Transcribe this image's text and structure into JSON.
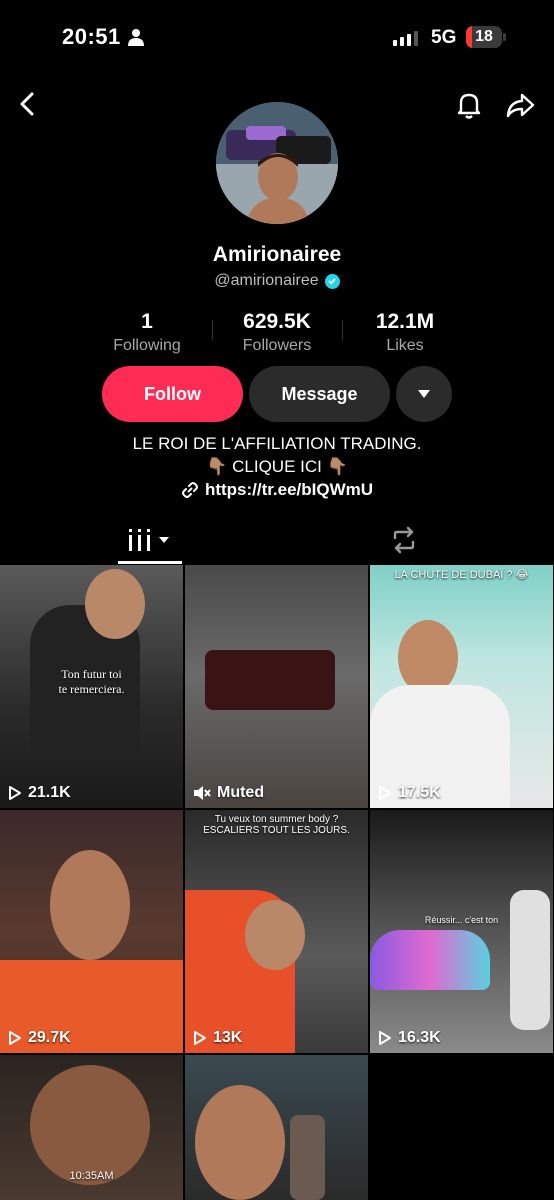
{
  "status": {
    "time": "20:51",
    "network": "5G",
    "battery": "18",
    "battery_level": 0.18
  },
  "profile": {
    "display_name": "Amirionairee",
    "handle": "@amirionairee",
    "stats": [
      {
        "value": "1",
        "label": "Following"
      },
      {
        "value": "629.5K",
        "label": "Followers"
      },
      {
        "value": "12.1M",
        "label": "Likes"
      }
    ],
    "buttons": {
      "follow": "Follow",
      "message": "Message"
    },
    "bio_line1": "LE ROI DE L'AFFILIATION TRADING.",
    "bio_line2": "👇🏽 CLIQUE ICI 👇🏽",
    "link": "https://tr.ee/bIQWmU"
  },
  "videos": [
    {
      "count": "21.1K",
      "caption": "Ton futur toi\nte remerciera."
    },
    {
      "count": "Muted",
      "caption": ""
    },
    {
      "count": "17.5K",
      "caption": "LA CHUTE DE DUBAÏ ? 😂"
    },
    {
      "count": "29.7K",
      "caption": ""
    },
    {
      "count": "13K",
      "caption": "Tu veux ton summer body ?\nESCALIERS TOUT LES JOURS."
    },
    {
      "count": "16.3K",
      "caption": "Réussir... c'est ton"
    },
    {
      "count": "",
      "caption": "10:35AM"
    },
    {
      "count": "",
      "caption": ""
    }
  ],
  "colors": {
    "accent": "#fe2c55",
    "verified": "#20d5ec",
    "button_dark": "#2b2b2b"
  }
}
